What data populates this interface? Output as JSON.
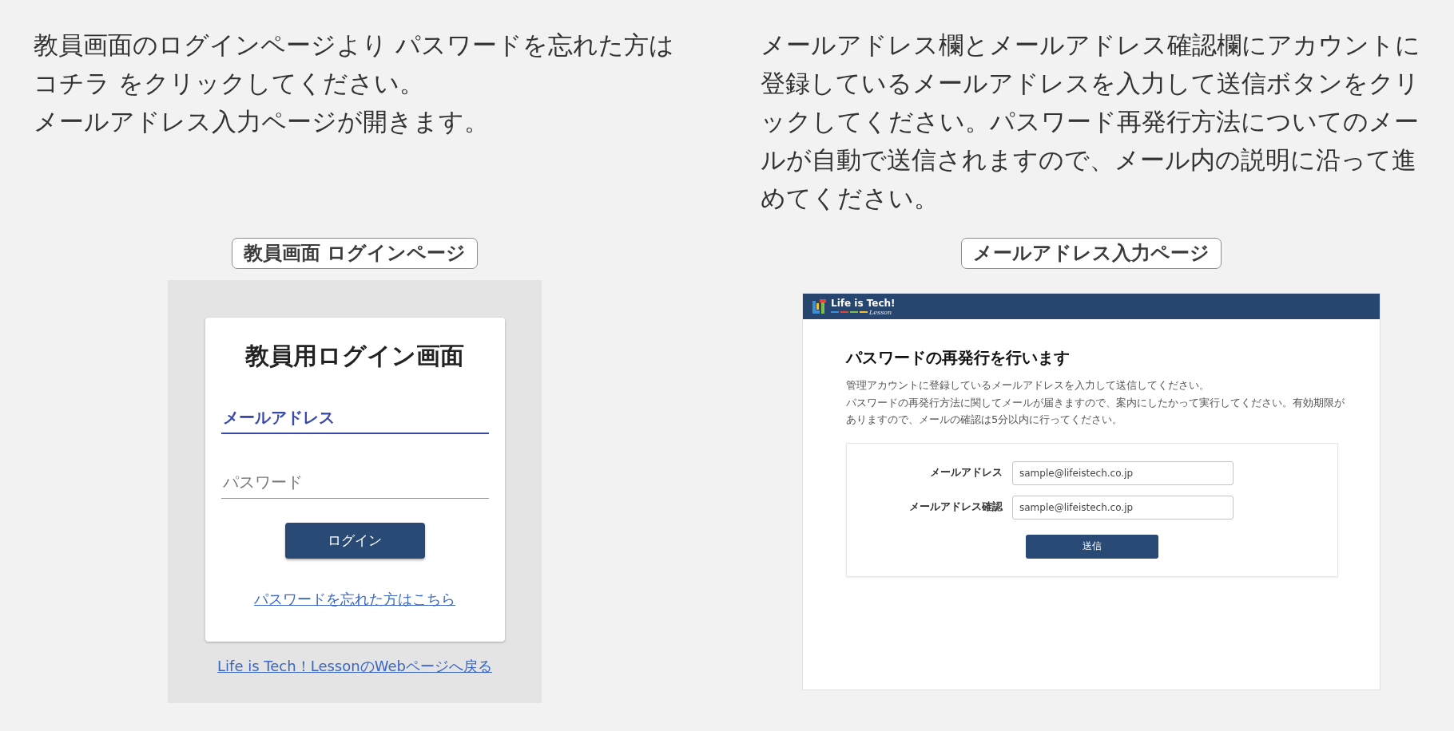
{
  "login_step": {
    "instructions": [
      "教員画面のログインページより パスワードを忘れた方はコチラ をクリックしてください。",
      "メールアドレス入力ページが開きます。"
    ],
    "caption": "教員画面 ログインページ",
    "screen": {
      "card_title": "教員用ログイン画面",
      "fields": [
        {
          "label": "メールアドレス",
          "focused": true
        },
        {
          "label": "パスワード",
          "focused": false
        }
      ],
      "login_button": "ログイン",
      "forgot_link": "パスワードを忘れた方はこちら",
      "back_link": "Life is Tech！LessonのWebページへ戻る"
    }
  },
  "reset_step": {
    "instructions": [
      "メールアドレス欄とメールアドレス確認欄にアカウントに登録しているメールアドレスを入力して送信ボタンをクリックしてください。パスワード再発行方法についてのメールが自動で送信されますので、メール内の説明に沿って進めてください。"
    ],
    "caption": "メールアドレス入力ページ",
    "screen": {
      "header": {
        "logo_text": "Life is Tech!",
        "logo_subtitle": "Lesson"
      },
      "title": "パスワードの再発行を行います",
      "description": [
        "管理アカウントに登録しているメールアドレスを入力して送信してください。",
        "パスワードの再発行方法に関してメールが届きますので、案内にしたかって実行してください。有効期限がありますので、メールの確認は5分以内に行ってください。"
      ],
      "form": {
        "fields": [
          {
            "label": "メールアドレス",
            "value": "sample@lifeistech.co.jp"
          },
          {
            "label": "メールアドレス確認",
            "value": "sample@lifeistech.co.jp"
          }
        ],
        "submit_button": "送信"
      }
    }
  }
}
